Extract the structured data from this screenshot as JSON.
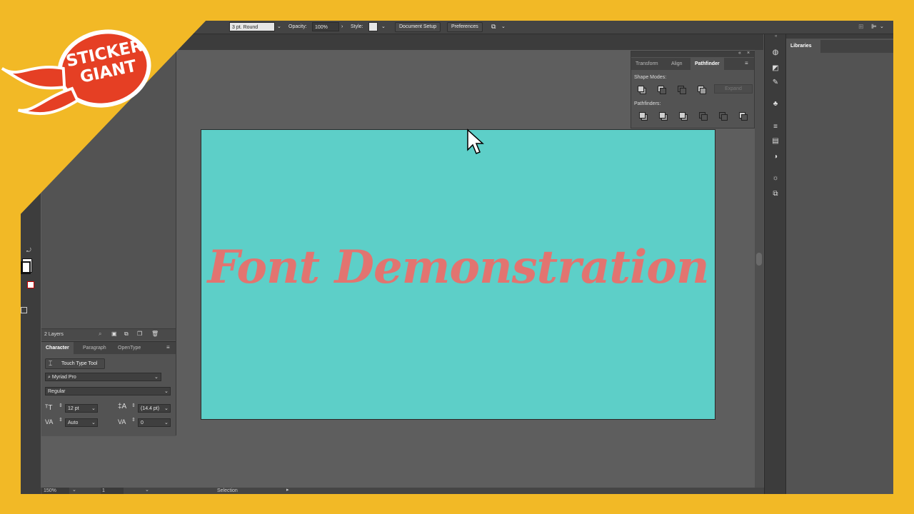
{
  "control_bar": {
    "stroke_style": "3 pt. Round",
    "opacity_label": "Opacity:",
    "opacity_value": "100%",
    "style_label": "Style:",
    "document_setup": "Document Setup",
    "preferences": "Preferences"
  },
  "logo": {
    "line1": "STICKER",
    "line2": "GIANT"
  },
  "artboard": {
    "text": "Font Demonstration",
    "bg_color": "#5DCFC8",
    "text_color": "#E27470"
  },
  "pathfinder_panel": {
    "tabs": [
      "Transform",
      "Align",
      "Pathfinder"
    ],
    "active_tab": "Pathfinder",
    "shape_modes_label": "Shape Modes:",
    "expand_label": "Expand",
    "pathfinders_label": "Pathfinders:"
  },
  "layers": {
    "count_label": "2 Layers"
  },
  "character_panel": {
    "tabs": [
      "Character",
      "Paragraph",
      "OpenType"
    ],
    "active_tab": "Character",
    "touch_type_tool": "Touch Type Tool",
    "font_family": "Myriad Pro",
    "font_style": "Regular",
    "font_size": "12 pt",
    "leading": "(14.4 pt)",
    "kerning": "Auto",
    "tracking": "0"
  },
  "libraries_panel": {
    "title": "Libraries"
  },
  "status_bar": {
    "zoom": "150%",
    "artboard_number": "1",
    "tool": "Selection"
  },
  "colors": {
    "frame": "#F2B926",
    "app_bg": "#535353",
    "canvas": "#5E5E5E"
  }
}
